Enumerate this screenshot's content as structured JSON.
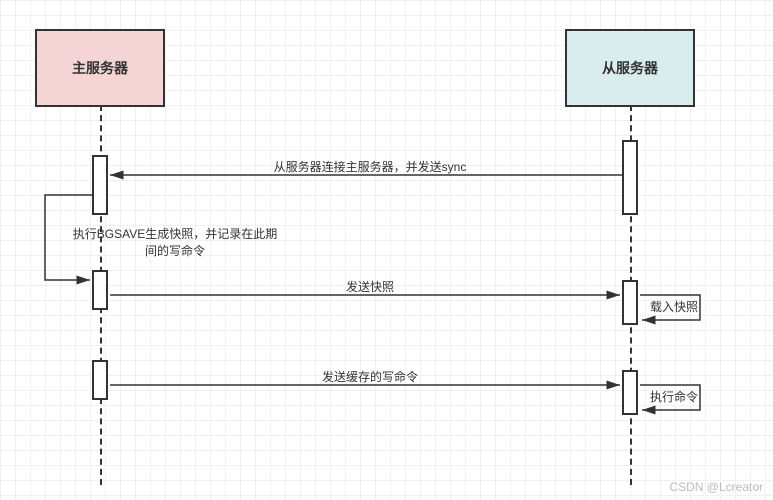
{
  "diagram": {
    "master": "主服务器",
    "slave": "从服务器",
    "msg1": "从服务器连接主服务器，并发送sync",
    "self_note": "执行BGSAVE生成快照，并记录在此期\n间的写命令",
    "msg2": "发送快照",
    "side_note1": "载入快照",
    "msg3": "发送缓存的写命令",
    "side_note2": "执行命令"
  },
  "watermark": "CSDN @Lcreator",
  "chart_data": {
    "type": "sequence-diagram",
    "participants": [
      {
        "id": "master",
        "label": "主服务器"
      },
      {
        "id": "slave",
        "label": "从服务器"
      }
    ],
    "messages": [
      {
        "from": "slave",
        "to": "master",
        "text": "从服务器连接主服务器，并发送sync"
      },
      {
        "from": "master",
        "to": "master",
        "text": "执行BGSAVE生成快照，并记录在此期间的写命令"
      },
      {
        "from": "master",
        "to": "slave",
        "text": "发送快照"
      },
      {
        "from": "slave",
        "to": "slave",
        "text": "载入快照"
      },
      {
        "from": "master",
        "to": "slave",
        "text": "发送缓存的写命令"
      },
      {
        "from": "slave",
        "to": "slave",
        "text": "执行命令"
      }
    ]
  }
}
